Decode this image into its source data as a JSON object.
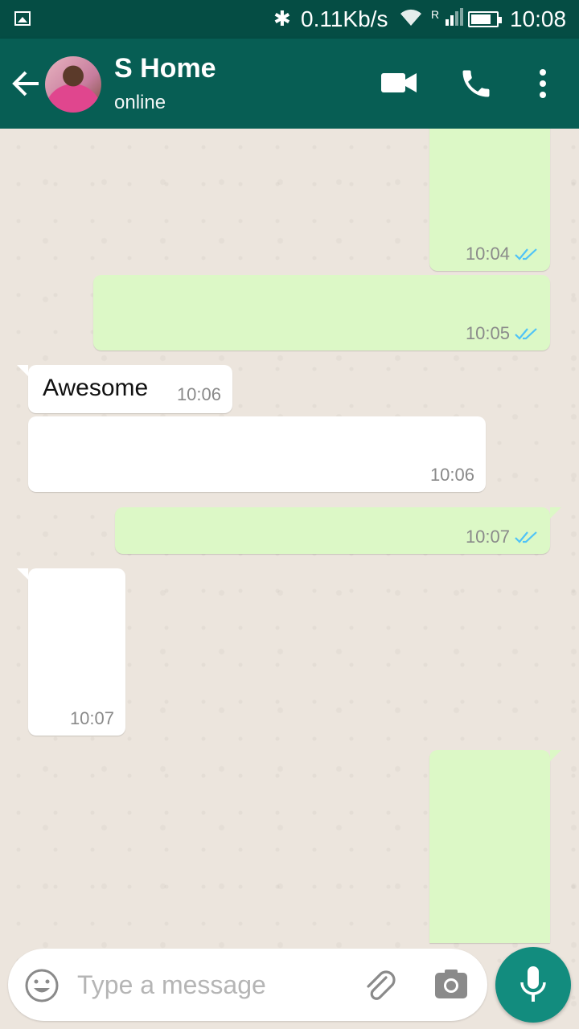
{
  "status_bar": {
    "speed": "0.11Kb/s",
    "time": "10:08",
    "signal_label": "R",
    "battery_percent": 80,
    "icons": [
      "gallery-icon",
      "bluetooth-icon",
      "wifi-icon",
      "signal-icon",
      "battery-icon"
    ]
  },
  "header": {
    "contact_name": "S Home",
    "status": "online",
    "icons": [
      "back-arrow-icon",
      "video-call-icon",
      "phone-icon",
      "more-vert-icon"
    ],
    "color": "#075e54"
  },
  "messages": [
    {
      "direction": "outgoing",
      "text": "",
      "time": "10:04",
      "read": true
    },
    {
      "direction": "outgoing",
      "text": "",
      "time": "10:05",
      "read": true
    },
    {
      "direction": "incoming",
      "text": "Awesome",
      "time": "10:06"
    },
    {
      "direction": "incoming",
      "text": "",
      "time": "10:06"
    },
    {
      "direction": "outgoing",
      "text": "",
      "time": "10:07",
      "read": true
    },
    {
      "direction": "incoming",
      "text": "",
      "time": "10:07"
    },
    {
      "direction": "outgoing",
      "text": "",
      "time": "",
      "read": false
    }
  ],
  "composer": {
    "placeholder": "Type a message",
    "value": "",
    "icons": [
      "emoji-icon",
      "attach-icon",
      "camera-icon",
      "mic-icon"
    ]
  },
  "colors": {
    "outgoing_bubble": "#dcf8c6",
    "incoming_bubble": "#ffffff",
    "read_ticks": "#4fc3f7",
    "mic_button": "#128c7e"
  }
}
